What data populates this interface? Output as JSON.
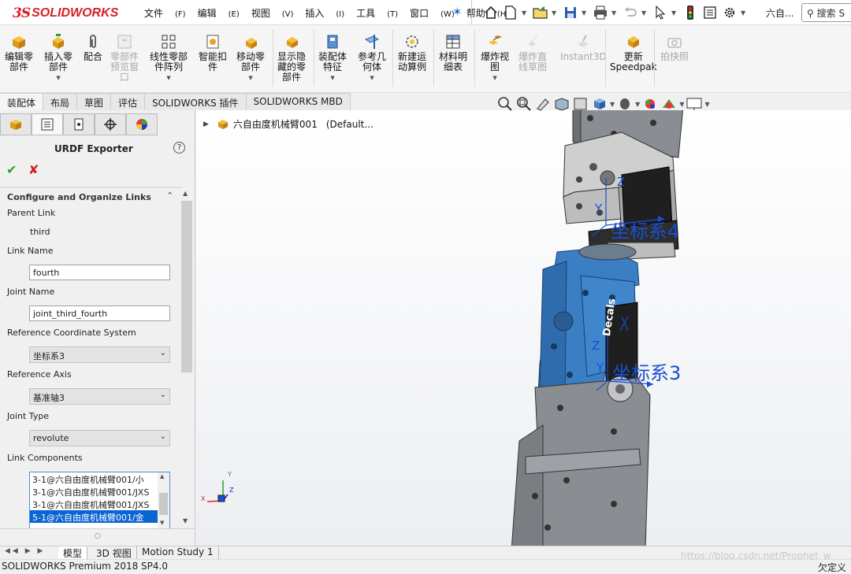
{
  "app": {
    "logo_mark": "3S",
    "logo_text": "SOLIDWORKS"
  },
  "menu": [
    {
      "label": "文件",
      "key": "(F)"
    },
    {
      "label": "编辑",
      "key": "(E)"
    },
    {
      "label": "视图",
      "key": "(V)"
    },
    {
      "label": "插入",
      "key": "(I)"
    },
    {
      "label": "工具",
      "key": "(T)"
    },
    {
      "label": "窗口",
      "key": "(W)"
    },
    {
      "label": "帮助",
      "key": "(H)"
    }
  ],
  "title_bar": {
    "doc_title": "六自...",
    "search_label": "搜索 S"
  },
  "ribbon": [
    {
      "line1": "编辑零",
      "line2": "部件",
      "line3": "",
      "disabled": false,
      "dropdown": false
    },
    {
      "line1": "插入零",
      "line2": "部件",
      "line3": "",
      "disabled": false,
      "dropdown": true
    },
    {
      "line1": "配合",
      "line2": "",
      "line3": "",
      "disabled": false,
      "dropdown": false
    },
    {
      "line1": "零部件",
      "line2": "预览窗",
      "line3": "口",
      "disabled": true,
      "dropdown": false
    },
    {
      "line1": "线性零部",
      "line2": "件阵列",
      "line3": "",
      "disabled": false,
      "dropdown": true
    },
    {
      "line1": "智能扣",
      "line2": "件",
      "line3": "",
      "disabled": false,
      "dropdown": false
    },
    {
      "line1": "移动零",
      "line2": "部件",
      "line3": "",
      "disabled": false,
      "dropdown": true
    },
    {
      "line1": "显示隐",
      "line2": "藏的零",
      "line3": "部件",
      "disabled": false,
      "dropdown": false
    },
    {
      "line1": "装配体",
      "line2": "特征",
      "line3": "",
      "disabled": false,
      "dropdown": true
    },
    {
      "line1": "参考几",
      "line2": "何体",
      "line3": "",
      "disabled": false,
      "dropdown": true
    },
    {
      "line1": "新建运",
      "line2": "动算例",
      "line3": "",
      "disabled": false,
      "dropdown": false
    },
    {
      "line1": "材料明",
      "line2": "细表",
      "line3": "",
      "disabled": false,
      "dropdown": false
    },
    {
      "line1": "爆炸视",
      "line2": "图",
      "line3": "",
      "disabled": false,
      "dropdown": true
    },
    {
      "line1": "爆炸直",
      "line2": "线草图",
      "line3": "",
      "disabled": true,
      "dropdown": false
    },
    {
      "line1": "Instant3D",
      "line2": "",
      "line3": "",
      "disabled": true,
      "dropdown": false
    },
    {
      "line1": "更新",
      "line2": "Speedpak",
      "line3": "",
      "disabled": false,
      "dropdown": false
    },
    {
      "line1": "拍快照",
      "line2": "",
      "line3": "",
      "disabled": true,
      "dropdown": false
    }
  ],
  "tabs": [
    "装配体",
    "布局",
    "草图",
    "评估",
    "SOLIDWORKS 插件",
    "SOLIDWORKS MBD"
  ],
  "panel": {
    "title": "URDF Exporter",
    "help": "?",
    "section_title": "Configure and Organize Links",
    "parent_link_label": "Parent Link",
    "parent_link_value": "third",
    "link_name_label": "Link Name",
    "link_name_value": "fourth",
    "joint_name_label": "Joint Name",
    "joint_name_value": "joint_third_fourth",
    "ref_coord_label": "Reference Coordinate System",
    "ref_coord_value": "坐标系3",
    "ref_axis_label": "Reference Axis",
    "ref_axis_value": "基准轴3",
    "joint_type_label": "Joint Type",
    "joint_type_value": "revolute",
    "link_components_label": "Link Components",
    "link_components": [
      "3-1@六自由度机械臂001/小",
      "3-1@六自由度机械臂001/JXS",
      "3-1@六自由度机械臂001/JXS",
      "5-1@六自由度机械臂001/金"
    ],
    "selected_component_index": 3
  },
  "tree": {
    "root_label": "六自由度机械臂001",
    "root_config": "(Default..."
  },
  "viewport": {
    "coord4_label": "坐标系4",
    "coord3_label": "坐标系3",
    "axis_z": "Z",
    "axis_y": "Y",
    "decal_text": "Decals",
    "triad_x": "X",
    "triad_y": "Y",
    "triad_z": "Z"
  },
  "bottom_tabs": [
    "模型",
    "3D 视图",
    "Motion Study 1"
  ],
  "status": {
    "left": "SOLIDWORKS Premium 2018 SP4.0",
    "right": "欠定义"
  },
  "watermark": "https://blog.csdn.net/Prophet_w",
  "colors": {
    "brand_red": "#d42027",
    "accent_blue": "#1a6fd0",
    "selection_blue": "#0a64d2",
    "coord_blue": "#1a4fd0",
    "part_blue": "#3a7fc4"
  }
}
